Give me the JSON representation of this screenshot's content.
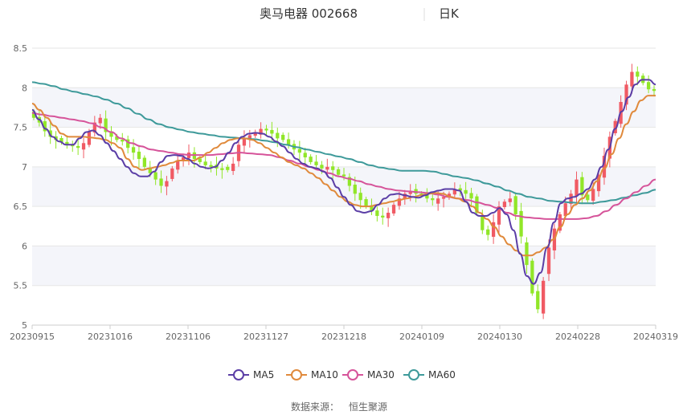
{
  "header": {
    "title": "奥马电器 002668",
    "period": "日K"
  },
  "footer": {
    "source_label": "数据来源：",
    "source_name": "恒生聚源"
  },
  "colors": {
    "up": "#f05a64",
    "down": "#91e628",
    "ma5": "#5b3ea6",
    "ma10": "#e08a3c",
    "ma30": "#d6549a",
    "ma60": "#3e9a9a",
    "grid": "#e6e6e6",
    "band": "#f4f5fa"
  },
  "chart_data": {
    "type": "candlestick",
    "title": "奥马电器 002668",
    "ylim": [
      5,
      8.5
    ],
    "yticks": [
      "5",
      "5.5",
      "6",
      "6.5",
      "7",
      "7.5",
      "8",
      "8.5"
    ],
    "xticks": [
      "20230915",
      "20231016",
      "20231106",
      "20231127",
      "20231218",
      "20240109",
      "20240130",
      "20240228",
      "20240319"
    ],
    "legend": [
      "MA5",
      "MA10",
      "MA30",
      "MA60"
    ],
    "close": [
      7.62,
      7.56,
      7.45,
      7.38,
      7.34,
      7.31,
      7.28,
      7.26,
      7.24,
      7.3,
      7.45,
      7.56,
      7.62,
      7.44,
      7.38,
      7.34,
      7.32,
      7.24,
      7.18,
      7.1,
      7.0,
      6.92,
      6.84,
      6.76,
      6.82,
      6.98,
      7.08,
      7.12,
      7.18,
      7.1,
      7.06,
      7.02,
      7.0,
      6.98,
      6.96,
      6.96,
      7.04,
      7.28,
      7.36,
      7.4,
      7.44,
      7.48,
      7.46,
      7.42,
      7.36,
      7.34,
      7.28,
      7.22,
      7.18,
      7.12,
      7.06,
      7.02,
      6.98,
      7.0,
      6.96,
      6.9,
      6.88,
      6.76,
      6.66,
      6.58,
      6.5,
      6.44,
      6.38,
      6.36,
      6.42,
      6.52,
      6.6,
      6.66,
      6.68,
      6.66,
      6.64,
      6.6,
      6.58,
      6.6,
      6.62,
      6.66,
      6.72,
      6.7,
      6.66,
      6.6,
      6.42,
      6.2,
      6.14,
      6.3,
      6.5,
      6.56,
      6.6,
      6.4,
      6.12,
      5.76,
      5.4,
      5.2,
      5.56,
      5.98,
      6.22,
      6.4,
      6.54,
      6.66,
      6.84,
      6.64,
      6.58,
      6.72,
      6.9,
      7.14,
      7.38,
      7.58,
      7.82,
      8.04,
      8.2,
      8.14,
      8.06,
      7.98,
      7.96
    ],
    "ma5": [
      7.72,
      7.6,
      7.48,
      7.38,
      7.32,
      7.28,
      7.28,
      7.36,
      7.44,
      7.46,
      7.4,
      7.3,
      7.2,
      7.1,
      7.0,
      6.92,
      6.88,
      6.88,
      6.94,
      7.06,
      7.14,
      7.15,
      7.14,
      7.1,
      7.04,
      7.0,
      6.98,
      7.0,
      7.08,
      7.18,
      7.3,
      7.38,
      7.42,
      7.43,
      7.42,
      7.38,
      7.32,
      7.26,
      7.18,
      7.1,
      7.04,
      7.0,
      6.98,
      6.94,
      6.86,
      6.74,
      6.62,
      6.52,
      6.44,
      6.42,
      6.44,
      6.52,
      6.6,
      6.65,
      6.66,
      6.64,
      6.62,
      6.61,
      6.64,
      6.68,
      6.7,
      6.72,
      6.72,
      6.7,
      6.56,
      6.42,
      6.38,
      6.38,
      6.42,
      6.48,
      6.4,
      6.2,
      5.9,
      5.62,
      5.52,
      5.66,
      5.98,
      6.3,
      6.54,
      6.6,
      6.62,
      6.66,
      6.72,
      6.84,
      7.0,
      7.22,
      7.48,
      7.7,
      7.88,
      8.04,
      8.1,
      8.1,
      8.04
    ],
    "ma10": [
      7.8,
      7.72,
      7.62,
      7.52,
      7.42,
      7.38,
      7.38,
      7.38,
      7.37,
      7.36,
      7.34,
      7.3,
      7.24,
      7.1,
      7.0,
      6.96,
      6.98,
      7.0,
      7.02,
      7.05,
      7.08,
      7.08,
      7.08,
      7.12,
      7.18,
      7.24,
      7.3,
      7.34,
      7.36,
      7.36,
      7.34,
      7.3,
      7.24,
      7.18,
      7.12,
      7.06,
      7.02,
      6.98,
      6.92,
      6.86,
      6.78,
      6.7,
      6.62,
      6.56,
      6.52,
      6.5,
      6.5,
      6.52,
      6.54,
      6.56,
      6.58,
      6.6,
      6.62,
      6.64,
      6.66,
      6.67,
      6.66,
      6.62,
      6.6,
      6.56,
      6.5,
      6.42,
      6.34,
      6.24,
      6.12,
      6.02,
      5.94,
      5.88,
      5.88,
      5.92,
      5.98,
      6.08,
      6.24,
      6.4,
      6.52,
      6.6,
      6.7,
      6.82,
      6.98,
      7.16,
      7.36,
      7.54,
      7.7,
      7.84,
      7.9,
      7.9
    ],
    "ma30": [
      7.68,
      7.66,
      7.64,
      7.62,
      7.6,
      7.58,
      7.55,
      7.5,
      7.44,
      7.36,
      7.3,
      7.26,
      7.22,
      7.2,
      7.18,
      7.16,
      7.15,
      7.15,
      7.15,
      7.16,
      7.17,
      7.18,
      7.17,
      7.16,
      7.15,
      7.12,
      7.08,
      7.04,
      7.0,
      6.96,
      6.92,
      6.88,
      6.85,
      6.82,
      6.78,
      6.75,
      6.72,
      6.7,
      6.69,
      6.68,
      6.67,
      6.65,
      6.62,
      6.6,
      6.58,
      6.55,
      6.52,
      6.48,
      6.42,
      6.38,
      6.36,
      6.35,
      6.34,
      6.34,
      6.34,
      6.34,
      6.35,
      6.38,
      6.44,
      6.52,
      6.6,
      6.68,
      6.76,
      6.84
    ],
    "ma60": [
      8.07,
      8.05,
      8.02,
      7.98,
      7.95,
      7.92,
      7.89,
      7.85,
      7.8,
      7.74,
      7.67,
      7.6,
      7.54,
      7.5,
      7.47,
      7.44,
      7.42,
      7.4,
      7.38,
      7.37,
      7.36,
      7.35,
      7.33,
      7.31,
      7.28,
      7.25,
      7.22,
      7.19,
      7.16,
      7.13,
      7.1,
      7.06,
      7.02,
      6.99,
      6.97,
      6.95,
      6.95,
      6.95,
      6.94,
      6.91,
      6.88,
      6.86,
      6.83,
      6.79,
      6.75,
      6.7,
      6.66,
      6.62,
      6.6,
      6.57,
      6.56,
      6.55,
      6.54,
      6.54,
      6.56,
      6.58,
      6.61,
      6.64,
      6.67,
      6.71
    ]
  }
}
